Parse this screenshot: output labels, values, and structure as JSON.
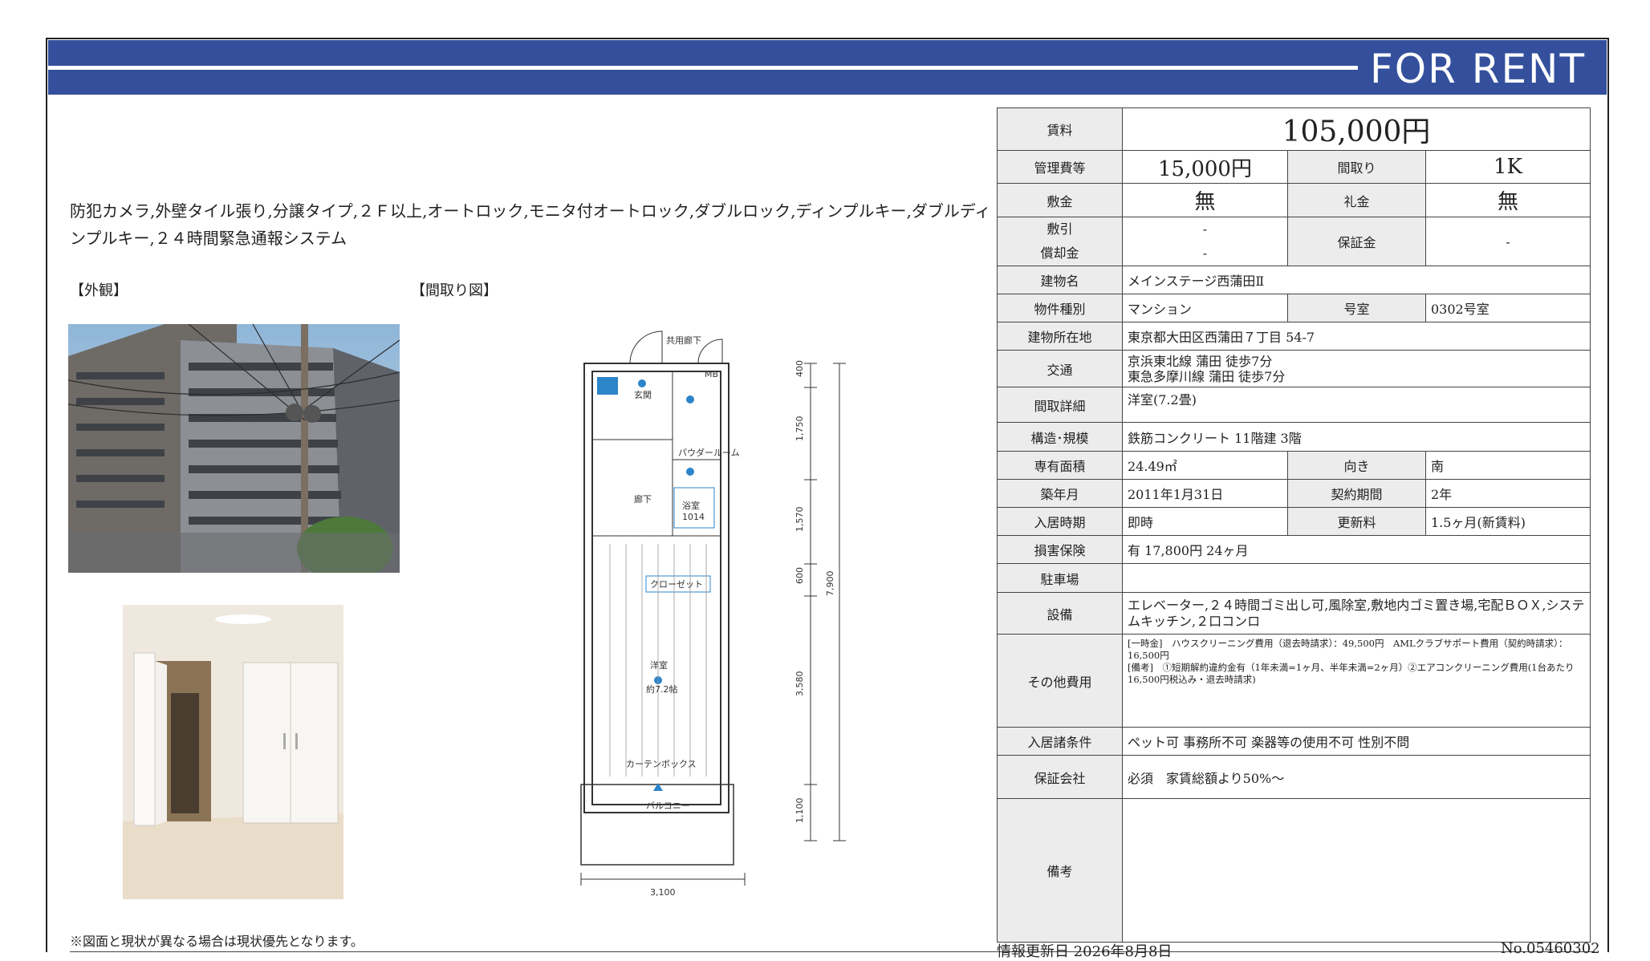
{
  "banner": {
    "title": "FOR RENT"
  },
  "features": "防犯カメラ,外壁タイル張り,分譲タイプ,２Ｆ以上,オートロック,モニタ付オートロック,ダブルロック,ディンプルキー,ダブルディンプルキー,２４時間緊急通報システム",
  "labels": {
    "exterior": "【外観】",
    "floorplan": "【間取り図】"
  },
  "floorplan_text": {
    "common_corridor": "共用廊下",
    "mb": "MB",
    "entrance": "玄関",
    "powder_room": "パウダールーム",
    "corridor": "廊下",
    "bathroom": "浴室",
    "bath_size": "1014",
    "closet": "クローゼット",
    "western_room": "洋室",
    "western_size": "約7.2帖",
    "balcony": "バルコニー",
    "curtain_box": "カーテンボックス",
    "dims": [
      "400",
      "1,750",
      "1,570",
      "600",
      "3,580",
      "1,100",
      "7,900",
      "3,100"
    ]
  },
  "note": "※図面と現状が異なる場合は現状優先となります。",
  "spec": {
    "rent_label": "賃料",
    "rent": "105,000円",
    "mgmt_label": "管理費等",
    "mgmt": "15,000円",
    "layout_label": "間取り",
    "layout": "1K",
    "deposit_label": "敷金",
    "deposit": "無",
    "key_money_label": "礼金",
    "key_money": "無",
    "shikibiki_label": "敷引",
    "shikibiki": "-",
    "shokyaku_label": "償却金",
    "shokyaku": "-",
    "guarantee_label": "保証金",
    "guarantee": "-",
    "building_name_label": "建物名",
    "building_name": "メインステージ西蒲田Ⅱ",
    "type_label": "物件種別",
    "type": "マンション",
    "room_label": "号室",
    "room": "0302号室",
    "address_label": "建物所在地",
    "address": "東京都大田区西蒲田７丁目 54-7",
    "transport_label": "交通",
    "transport1": "京浜東北線 蒲田 徒歩7分",
    "transport2": "東急多摩川線 蒲田 徒歩7分",
    "layout_detail_label": "間取詳細",
    "layout_detail": "洋室(7.2畳)",
    "structure_label": "構造･規模",
    "structure": "鉄筋コンクリート 11階建 3階",
    "area_label": "専有面積",
    "area": "24.49㎡",
    "direction_label": "向き",
    "direction": "南",
    "built_label": "築年月",
    "built": "2011年1月31日",
    "contract_label": "契約期間",
    "contract": "2年",
    "move_in_label": "入居時期",
    "move_in": "即時",
    "renewal_label": "更新料",
    "renewal": "1.5ヶ月(新賃料)",
    "insurance_label": "損害保険",
    "insurance": "有 17,800円 24ヶ月",
    "parking_label": "駐車場",
    "parking": "",
    "facilities_label": "設備",
    "facilities": "エレベーター,２４時間ゴミ出し可,風除室,敷地内ゴミ置き場,宅配ＢＯＸ,システムキッチン,２口コンロ",
    "other_fees_label": "その他費用",
    "other_fees1": "[一時金]　ハウスクリーニング費用（退去時請求）：49,500円　AMLクラブサポート費用（契約時請求）：16,500円",
    "other_fees2": "[備考]　①短期解約違約金有（1年未満=1ヶ月、半年未満=2ヶ月）②エアコンクリーニング費用(1台あたり16,500円税込み・退去時請求)",
    "conditions_label": "入居諸条件",
    "conditions": "ペット可 事務所不可 楽器等の使用不可 性別不問",
    "guarantor_label": "保証会社",
    "guarantor": "必須　家賃総額より50%～",
    "remarks_label": "備考",
    "remarks": ""
  },
  "footer": {
    "updated": "情報更新日 2026年8月8日",
    "number": "No.05460302"
  }
}
